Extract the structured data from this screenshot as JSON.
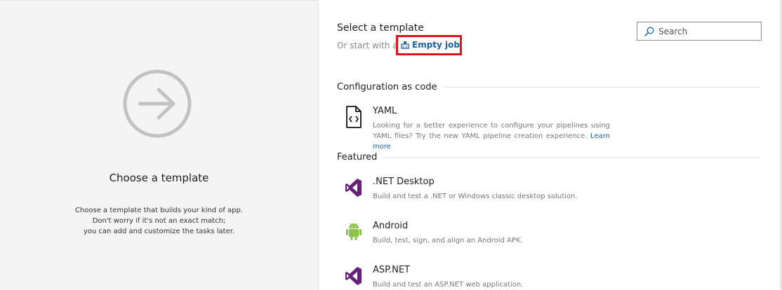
{
  "left": {
    "title": "Choose a template",
    "description_lines": [
      "Choose a template that builds your kind of app.",
      "Don't worry if it's not an exact match;",
      "you can add and customize the tasks later."
    ]
  },
  "header": {
    "title": "Select a template",
    "or_start_text": "Or start with an",
    "empty_job_label": "Empty job",
    "highlight_color": "#e0121c"
  },
  "search": {
    "placeholder": "Search"
  },
  "sections": {
    "config": {
      "title": "Configuration as code",
      "items": [
        {
          "name": "YAML",
          "description": "Looking for a better experience to configure your pipelines using YAML files? Try the new YAML pipeline creation experience.",
          "link": "Learn more",
          "icon": "yaml-file-icon"
        }
      ]
    },
    "featured": {
      "title": "Featured",
      "items": [
        {
          "name": ".NET Desktop",
          "description": "Build and test a .NET or Windows classic desktop solution.",
          "icon": "visual-studio-icon"
        },
        {
          "name": "Android",
          "description": "Build, test, sign, and align an Android APK.",
          "icon": "android-icon"
        },
        {
          "name": "ASP.NET",
          "description": "Build and test an ASP.NET web application.",
          "icon": "visual-studio-icon"
        }
      ]
    }
  },
  "colors": {
    "link": "#1d60a6",
    "vs_purple": "#68217a",
    "android_green": "#8bc34a"
  }
}
